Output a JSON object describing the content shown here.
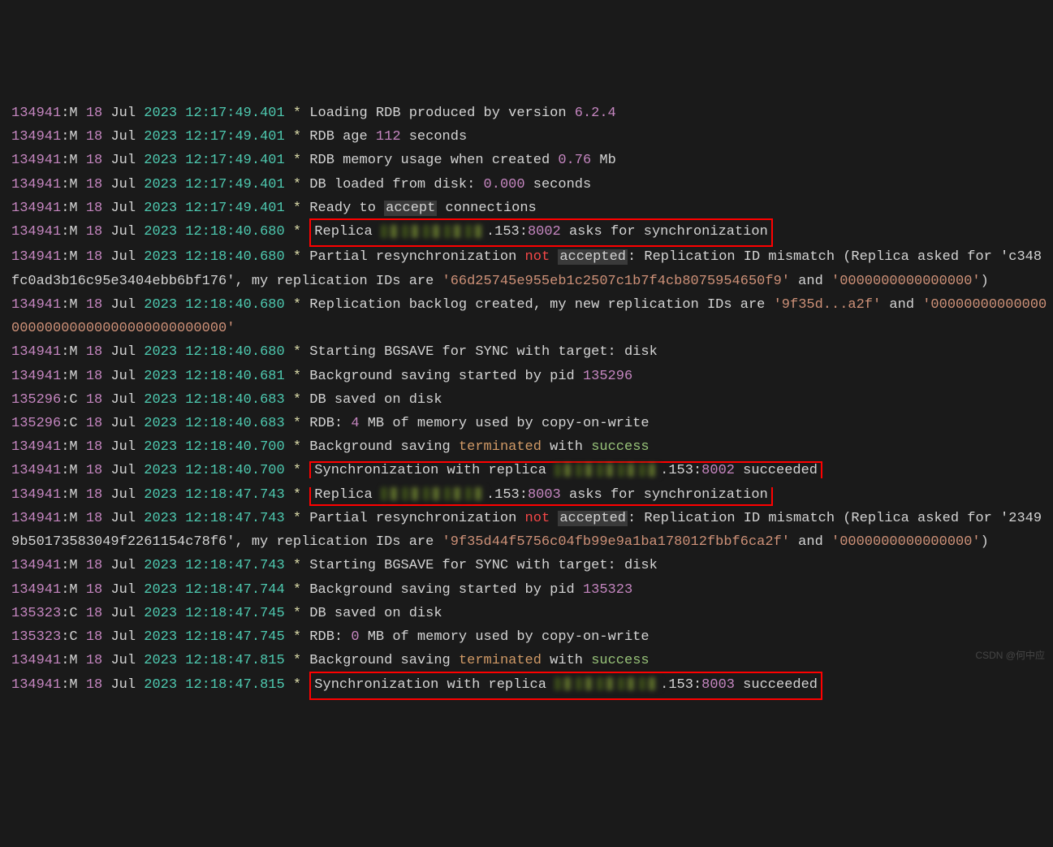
{
  "watermark": "CSDN @何中应",
  "lines": [
    {
      "pid": "134941",
      "role": "M",
      "day": "18",
      "month": "Jul",
      "year": "2023",
      "ts": "12:17:49.401",
      "type": "loading_rdb",
      "version": "6.2.4"
    },
    {
      "pid": "134941",
      "role": "M",
      "day": "18",
      "month": "Jul",
      "year": "2023",
      "ts": "12:17:49.401",
      "type": "rdb_age",
      "age": "112"
    },
    {
      "pid": "134941",
      "role": "M",
      "day": "18",
      "month": "Jul",
      "year": "2023",
      "ts": "12:17:49.401",
      "type": "rdb_mem",
      "mem": "0.76"
    },
    {
      "pid": "134941",
      "role": "M",
      "day": "18",
      "month": "Jul",
      "year": "2023",
      "ts": "12:17:49.401",
      "type": "db_loaded",
      "secs": "0.000"
    },
    {
      "pid": "134941",
      "role": "M",
      "day": "18",
      "month": "Jul",
      "year": "2023",
      "ts": "12:17:49.401",
      "type": "ready_accept"
    },
    {
      "pid": "134941",
      "role": "M",
      "day": "18",
      "month": "Jul",
      "year": "2023",
      "ts": "12:18:40.680",
      "type": "replica_asks",
      "ip_last": ".153",
      "port": "8002",
      "boxed": true
    },
    {
      "pid": "134941",
      "role": "M",
      "day": "18",
      "month": "Jul",
      "year": "2023",
      "ts": "12:18:40.680",
      "type": "partial_mismatch",
      "rid_req": "c348fc0ad3b16c95e3404ebb6bf176'",
      "rid1": "'66d25745e955eb1c2507c1b7f4cb8075954650f9'",
      "rid2": "'0000000000000000'"
    },
    {
      "pid": "134941",
      "role": "M",
      "day": "18",
      "month": "Jul",
      "year": "2023",
      "ts": "12:18:40.680",
      "type": "backlog_created",
      "new1": "'9f35d",
      "new1b": "a2f'",
      "new2": "'0000000000000000000000000000000000000000'"
    },
    {
      "pid": "134941",
      "role": "M",
      "day": "18",
      "month": "Jul",
      "year": "2023",
      "ts": "12:18:40.680",
      "type": "bgsave_start"
    },
    {
      "pid": "134941",
      "role": "M",
      "day": "18",
      "month": "Jul",
      "year": "2023",
      "ts": "12:18:40.681",
      "type": "bg_saving_pid",
      "bgpid": "135296"
    },
    {
      "pid": "135296",
      "role": "C",
      "day": "18",
      "month": "Jul",
      "year": "2023",
      "ts": "12:18:40.683",
      "type": "db_saved"
    },
    {
      "pid": "135296",
      "role": "C",
      "day": "18",
      "month": "Jul",
      "year": "2023",
      "ts": "12:18:40.683",
      "type": "rdb_cow",
      "mb": "4"
    },
    {
      "pid": "134941",
      "role": "M",
      "day": "18",
      "month": "Jul",
      "year": "2023",
      "ts": "12:18:40.700",
      "type": "bg_term_succ"
    },
    {
      "pid": "134941",
      "role": "M",
      "day": "18",
      "month": "Jul",
      "year": "2023",
      "ts": "12:18:40.700",
      "type": "sync_succeeded",
      "ip_last": ".153",
      "port": "8002",
      "boxed": "open"
    },
    {
      "pid": "134941",
      "role": "M",
      "day": "18",
      "month": "Jul",
      "year": "2023",
      "ts": "12:18:47.743",
      "type": "replica_asks",
      "ip_last": ".153",
      "port": "8003",
      "boxed": "close"
    },
    {
      "pid": "134941",
      "role": "M",
      "day": "18",
      "month": "Jul",
      "year": "2023",
      "ts": "12:18:47.743",
      "type": "partial_mismatch",
      "rid_req": "23499b50173583049f2261154c78f6'",
      "rid1": "'9f35d44f5756c04fb99e9a1ba178012fbbf6ca2f'",
      "rid2": "'0000000000000000'"
    },
    {
      "pid": "134941",
      "role": "M",
      "day": "18",
      "month": "Jul",
      "year": "2023",
      "ts": "12:18:47.743",
      "type": "bgsave_start"
    },
    {
      "pid": "134941",
      "role": "M",
      "day": "18",
      "month": "Jul",
      "year": "2023",
      "ts": "12:18:47.744",
      "type": "bg_saving_pid",
      "bgpid": "135323"
    },
    {
      "pid": "135323",
      "role": "C",
      "day": "18",
      "month": "Jul",
      "year": "2023",
      "ts": "12:18:47.745",
      "type": "db_saved"
    },
    {
      "pid": "135323",
      "role": "C",
      "day": "18",
      "month": "Jul",
      "year": "2023",
      "ts": "12:18:47.745",
      "type": "rdb_cow",
      "mb": "0"
    },
    {
      "pid": "134941",
      "role": "M",
      "day": "18",
      "month": "Jul",
      "year": "2023",
      "ts": "12:18:47.815",
      "type": "bg_term_succ"
    },
    {
      "pid": "134941",
      "role": "M",
      "day": "18",
      "month": "Jul",
      "year": "2023",
      "ts": "12:18:47.815",
      "type": "sync_succeeded",
      "ip_last": ".153",
      "port": "8003",
      "boxed": true
    }
  ],
  "labels": {
    "loading_rdb_pre": "Loading RDB produced by version ",
    "rdb_age_pre": "RDB age ",
    "rdb_age_post": " seconds",
    "rdb_mem_pre": "RDB memory usage when created ",
    "rdb_mem_post": " Mb",
    "db_loaded_pre": "DB loaded from disk: ",
    "db_loaded_post": " seconds",
    "ready_pre": "Ready to ",
    "accept": "accept",
    "ready_post": " connections",
    "replica": "Replica ",
    "asks_sync": " asks for synchronization",
    "partial_pre": "Partial resynchronization ",
    "not": "not",
    "accepted": " accepted",
    "mismatch": ": Replication ID mismatch (Replica asked for '",
    "my_ids": ", my replication IDs are ",
    "and": " and ",
    "close_paren": ")",
    "backlog_pre": "Replication backlog created, my new replication IDs are ",
    "bgsave": "Starting BGSAVE for SYNC with target: disk",
    "bg_saving_pre": "Background saving started by pid ",
    "db_saved": "DB saved on disk",
    "rdb_cow_pre": "RDB: ",
    "rdb_cow_post": " MB of memory used by copy-on-write",
    "bg_term_pre": "Background saving ",
    "terminated": "terminated",
    "with": " with ",
    "success": "success",
    "sync_pre": "Synchronization with replica ",
    "succeeded": " succeeded"
  }
}
